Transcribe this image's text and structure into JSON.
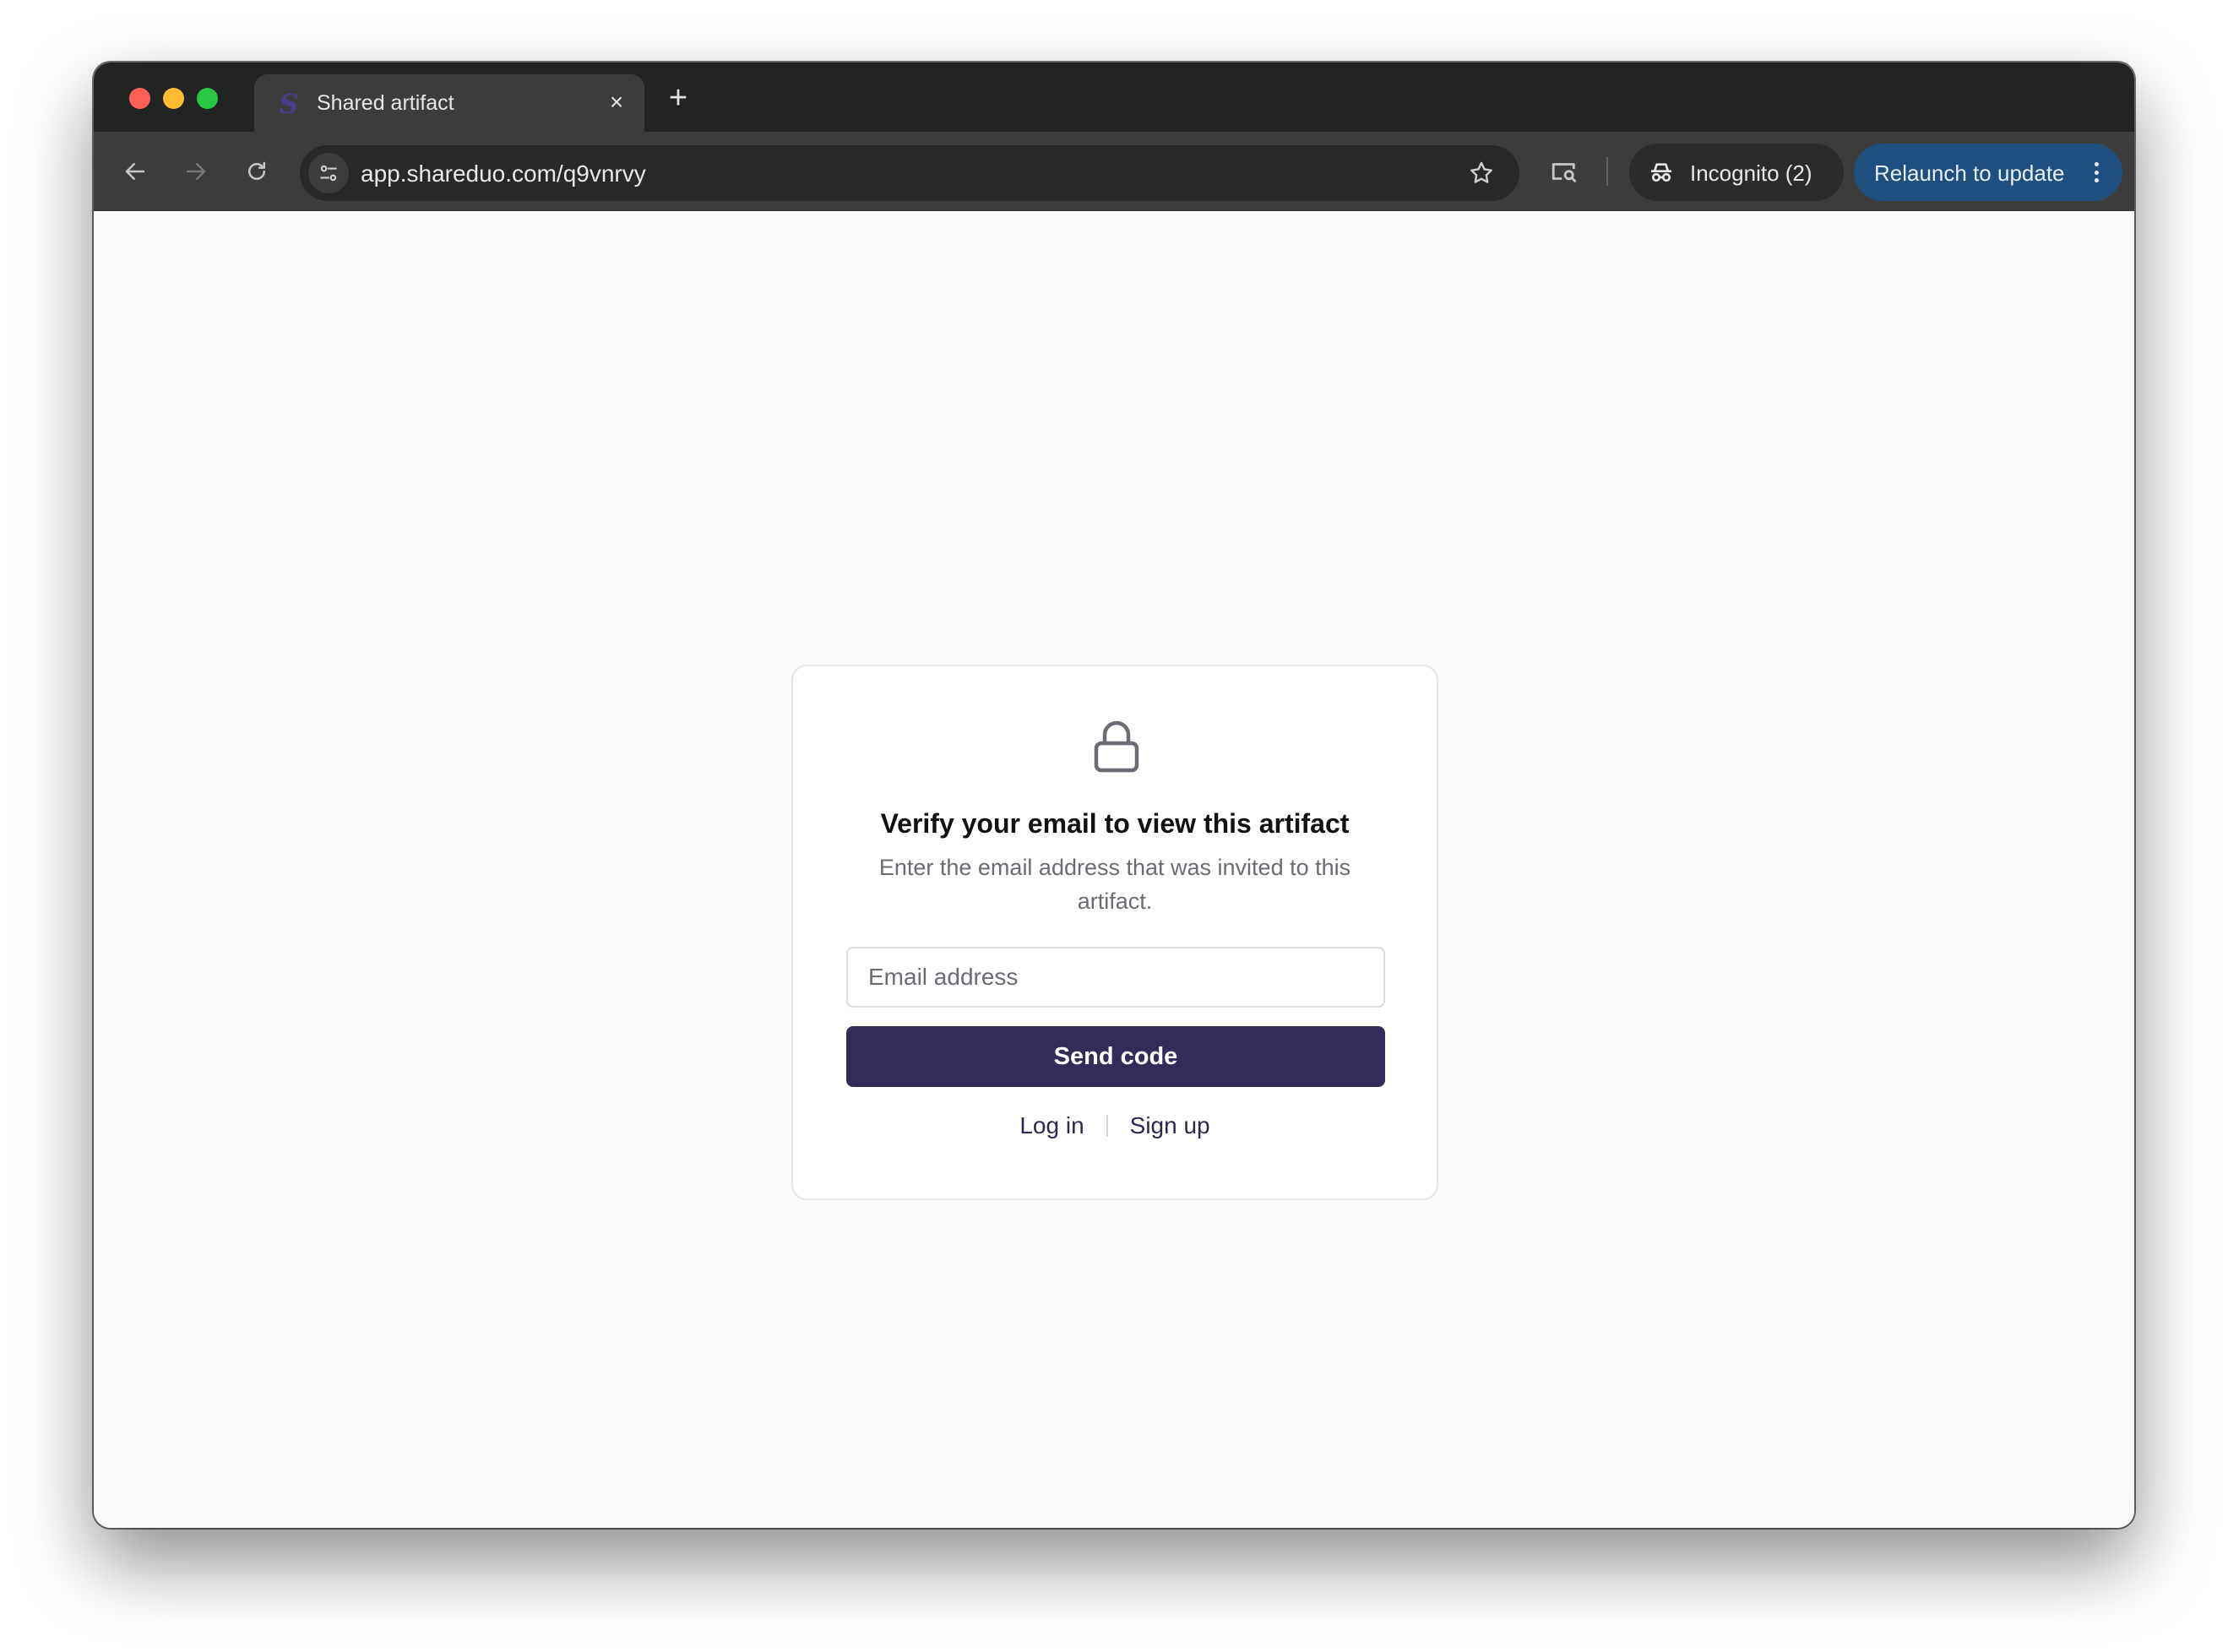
{
  "browser": {
    "tab": {
      "title": "Shared artifact",
      "favicon": "S",
      "close": "×"
    },
    "new_tab": "+",
    "address_bar": {
      "url": "app.shareduo.com/q9vnrvy"
    },
    "incognito": {
      "label": "Incognito (2)"
    },
    "relaunch": {
      "label": "Relaunch to update"
    }
  },
  "verify_card": {
    "title": "Verify your email to view this artifact",
    "description": "Enter the email address that was invited to this artifact.",
    "email_placeholder": "Email address",
    "email_value": "",
    "send_button": "Send code",
    "login_link": "Log in",
    "signup_link": "Sign up"
  },
  "colors": {
    "primary_button": "#352b5a",
    "relaunch_button": "#1f4f7e",
    "browser_frame": "#222423",
    "page_background": "#fafafa"
  },
  "icons": {
    "card": "lock-icon",
    "toolbar": [
      "back-arrow-icon",
      "forward-arrow-icon",
      "reload-icon",
      "site-info-icon",
      "star-icon",
      "lens-icon",
      "incognito-icon",
      "more-vert-icon"
    ]
  }
}
